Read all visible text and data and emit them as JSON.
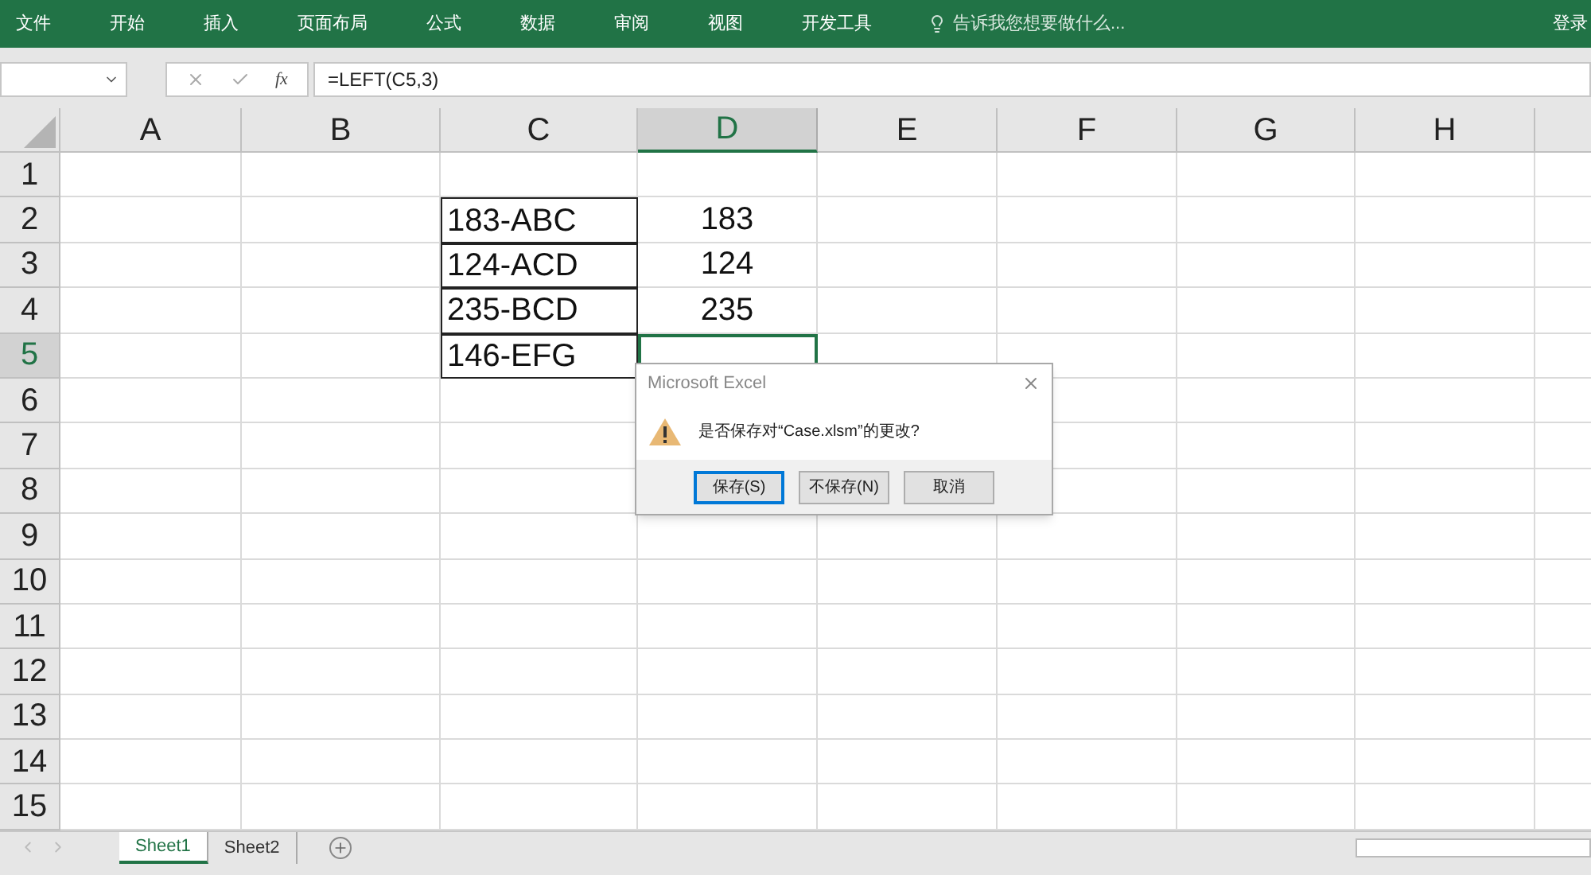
{
  "ribbon": {
    "tabs": [
      {
        "label": "文件",
        "selected": false
      },
      {
        "label": "开始",
        "selected": false
      },
      {
        "label": "插入",
        "selected": false
      },
      {
        "label": "页面布局",
        "selected": false
      },
      {
        "label": "公式",
        "selected": false
      },
      {
        "label": "数据",
        "selected": false
      },
      {
        "label": "审阅",
        "selected": false
      },
      {
        "label": "视图",
        "selected": false
      },
      {
        "label": "开发工具",
        "selected": false
      }
    ],
    "tell_me": "告诉我您想要做什么...",
    "sign_in": "登录"
  },
  "formula_bar": {
    "fx": "fx",
    "formula": "=LEFT(C5,3)"
  },
  "columns": [
    {
      "label": "A",
      "selected": false
    },
    {
      "label": "B",
      "selected": false
    },
    {
      "label": "C",
      "selected": false
    },
    {
      "label": "D",
      "selected": true
    },
    {
      "label": "E",
      "selected": false
    },
    {
      "label": "F",
      "selected": false
    },
    {
      "label": "G",
      "selected": false
    },
    {
      "label": "H",
      "selected": false
    }
  ],
  "rows": [
    {
      "label": "1",
      "selected": false,
      "cells": [
        null,
        null,
        null,
        null,
        null,
        null,
        null,
        null
      ]
    },
    {
      "label": "2",
      "selected": false,
      "cells": [
        null,
        null,
        {
          "text": "183-ABC",
          "boxed": true,
          "selected": false
        },
        {
          "text": "183",
          "boxed": false,
          "selected": false
        },
        null,
        null,
        null,
        null
      ]
    },
    {
      "label": "3",
      "selected": false,
      "cells": [
        null,
        null,
        {
          "text": "124-ACD",
          "boxed": true,
          "selected": false
        },
        {
          "text": "124",
          "boxed": false,
          "selected": false
        },
        null,
        null,
        null,
        null
      ]
    },
    {
      "label": "4",
      "selected": false,
      "cells": [
        null,
        null,
        {
          "text": "235-BCD",
          "boxed": true,
          "selected": false
        },
        {
          "text": "235",
          "boxed": false,
          "selected": false
        },
        null,
        null,
        null,
        null
      ]
    },
    {
      "label": "5",
      "selected": true,
      "cells": [
        null,
        null,
        {
          "text": "146-EFG",
          "boxed": true,
          "selected": false
        },
        {
          "boxed": false,
          "selected": true
        },
        null,
        null,
        null,
        null
      ]
    },
    {
      "label": "6",
      "selected": false,
      "cells": [
        null,
        null,
        null,
        null,
        null,
        null,
        null,
        null
      ]
    },
    {
      "label": "7",
      "selected": false,
      "cells": [
        null,
        null,
        null,
        null,
        null,
        null,
        null,
        null
      ]
    },
    {
      "label": "8",
      "selected": false,
      "cells": [
        null,
        null,
        null,
        null,
        null,
        null,
        null,
        null
      ]
    },
    {
      "label": "9",
      "selected": false,
      "cells": [
        null,
        null,
        null,
        null,
        null,
        null,
        null,
        null
      ]
    },
    {
      "label": "10",
      "selected": false,
      "cells": [
        null,
        null,
        null,
        null,
        null,
        null,
        null,
        null
      ]
    },
    {
      "label": "11",
      "selected": false,
      "cells": [
        null,
        null,
        null,
        null,
        null,
        null,
        null,
        null
      ]
    },
    {
      "label": "12",
      "selected": false,
      "cells": [
        null,
        null,
        null,
        null,
        null,
        null,
        null,
        null
      ]
    },
    {
      "label": "13",
      "selected": false,
      "cells": [
        null,
        null,
        null,
        null,
        null,
        null,
        null,
        null
      ]
    },
    {
      "label": "14",
      "selected": false,
      "cells": [
        null,
        null,
        null,
        null,
        null,
        null,
        null,
        null
      ]
    },
    {
      "label": "15",
      "selected": false,
      "cells": [
        null,
        null,
        null,
        null,
        null,
        null,
        null,
        null
      ]
    }
  ],
  "sheet_tabs": [
    {
      "label": "Sheet1",
      "selected": true
    },
    {
      "label": "Sheet2",
      "selected": false
    }
  ],
  "dialog": {
    "title": "Microsoft Excel",
    "message": "是否保存对“Case.xlsm”的更改?",
    "buttons": [
      {
        "label": "保存(S)",
        "default": true
      },
      {
        "label": "不保存(N)",
        "default": false
      },
      {
        "label": "取消",
        "default": false
      }
    ]
  }
}
